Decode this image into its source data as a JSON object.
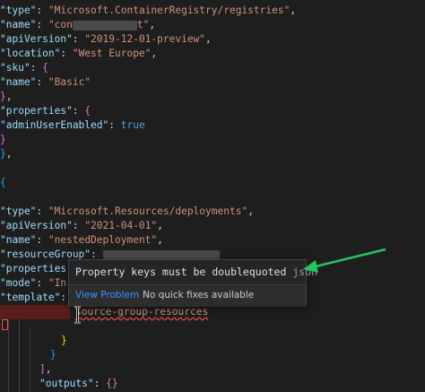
{
  "code": {
    "l1_key": "\"type\"",
    "l1_val": "\"Microsoft.ContainerRegistry/registries\"",
    "l2_key": "\"name\"",
    "l2_val_start": "\"con",
    "l2_val_end": "t\"",
    "l3_key": "\"apiVersion\"",
    "l3_val": "\"2019-12-01-preview\"",
    "l4_key": "\"location\"",
    "l4_val": "\"West Europe\"",
    "l5_key": "\"sku\"",
    "l6_key": "\"name\"",
    "l6_val": "\"Basic\"",
    "l8_key": "\"properties\"",
    "l9_key": "\"adminUserEnabled\"",
    "l9_val": "true",
    "l13_key": "\"type\"",
    "l13_val": "\"Microsoft.Resources/deployments\"",
    "l14_key": "\"apiVersion\"",
    "l14_val": "\"2021-04-01\"",
    "l15_key": "\"name\"",
    "l15_val": "\"nestedDeployment\"",
    "l16_key": "\"resourceGroup\"",
    "l17_key": "\"properties\"",
    "l18_key": "\"mode\"",
    "l18_val": "\"In",
    "l19_key": "\"template\"",
    "l20_text": "source-group-resources",
    "l25_key": "\"outputs\""
  },
  "hover": {
    "message": "Property keys must be doublequoted",
    "source": "json",
    "view_problem": "View Problem",
    "no_fixes": "No quick fixes available"
  },
  "colors": {
    "key": "#9cdcfe",
    "string": "#ce9178",
    "keyword": "#569cd6",
    "error": "#f14c4c",
    "annotation_arrow": "#22c55e"
  }
}
